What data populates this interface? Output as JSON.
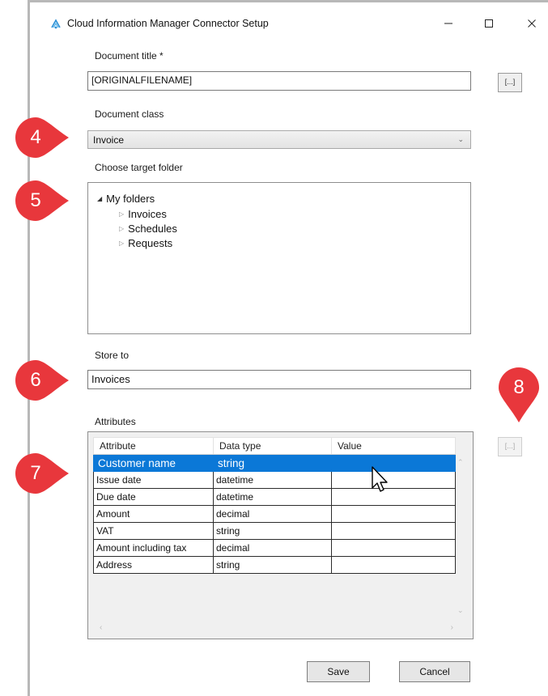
{
  "window": {
    "title": "Cloud Information Manager Connector Setup"
  },
  "form": {
    "document_title_label": "Document title *",
    "document_title_value": "[ORIGINALFILENAME]",
    "browse_label": "[...]",
    "document_class_label": "Document class",
    "document_class_value": "Invoice",
    "target_folder_label": "Choose target folder",
    "tree": {
      "root": "My folders",
      "children": [
        "Invoices",
        "Schedules",
        "Requests"
      ]
    },
    "store_to_label": "Store to",
    "store_to_value": "Invoices",
    "attributes_label": "Attributes"
  },
  "attributes": {
    "columns": [
      "Attribute",
      "Data type",
      "Value"
    ],
    "rows": [
      {
        "attribute": "Customer name",
        "type": "string",
        "value": ""
      },
      {
        "attribute": "Issue date",
        "type": "datetime",
        "value": ""
      },
      {
        "attribute": "Due date",
        "type": "datetime",
        "value": ""
      },
      {
        "attribute": "Amount",
        "type": "decimal",
        "value": ""
      },
      {
        "attribute": "VAT",
        "type": "string",
        "value": ""
      },
      {
        "attribute": "Amount including tax",
        "type": "decimal",
        "value": ""
      },
      {
        "attribute": "Address",
        "type": "string",
        "value": ""
      }
    ],
    "selected_row": 0
  },
  "buttons": {
    "save": "Save",
    "cancel": "Cancel"
  },
  "callouts": [
    "4",
    "5",
    "6",
    "7",
    "8"
  ],
  "colors": {
    "callout": "#e8373c",
    "selection": "#0b78d7"
  }
}
